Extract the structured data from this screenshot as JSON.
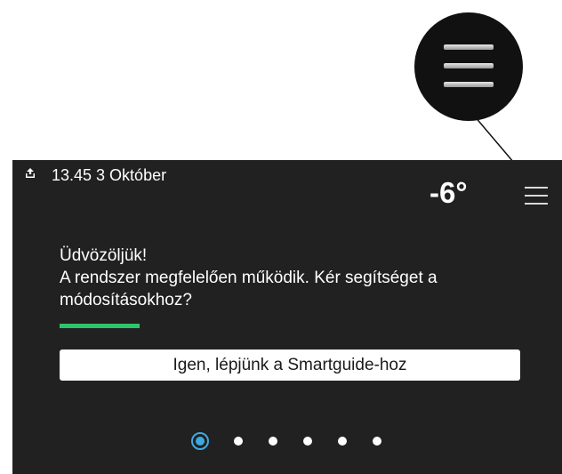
{
  "callout": {
    "icon": "hamburger-menu-icon"
  },
  "status": {
    "icon": "upload-icon",
    "datetime": "13.45 3  Október"
  },
  "header": {
    "outdoor_temp": "-6°",
    "menu_icon": "hamburger-menu-icon"
  },
  "message": {
    "title": "Üdvözöljük!",
    "body": "A rendszer megfelelően működik. Kér segítséget a módosításokhoz?"
  },
  "progress": {
    "value": 0.2,
    "color": "#2ec46b"
  },
  "action": {
    "label": "Igen, lépjünk a Smartguide-hoz"
  },
  "pagination": {
    "total": 6,
    "current": 1,
    "active_color": "#3fa8e0"
  }
}
